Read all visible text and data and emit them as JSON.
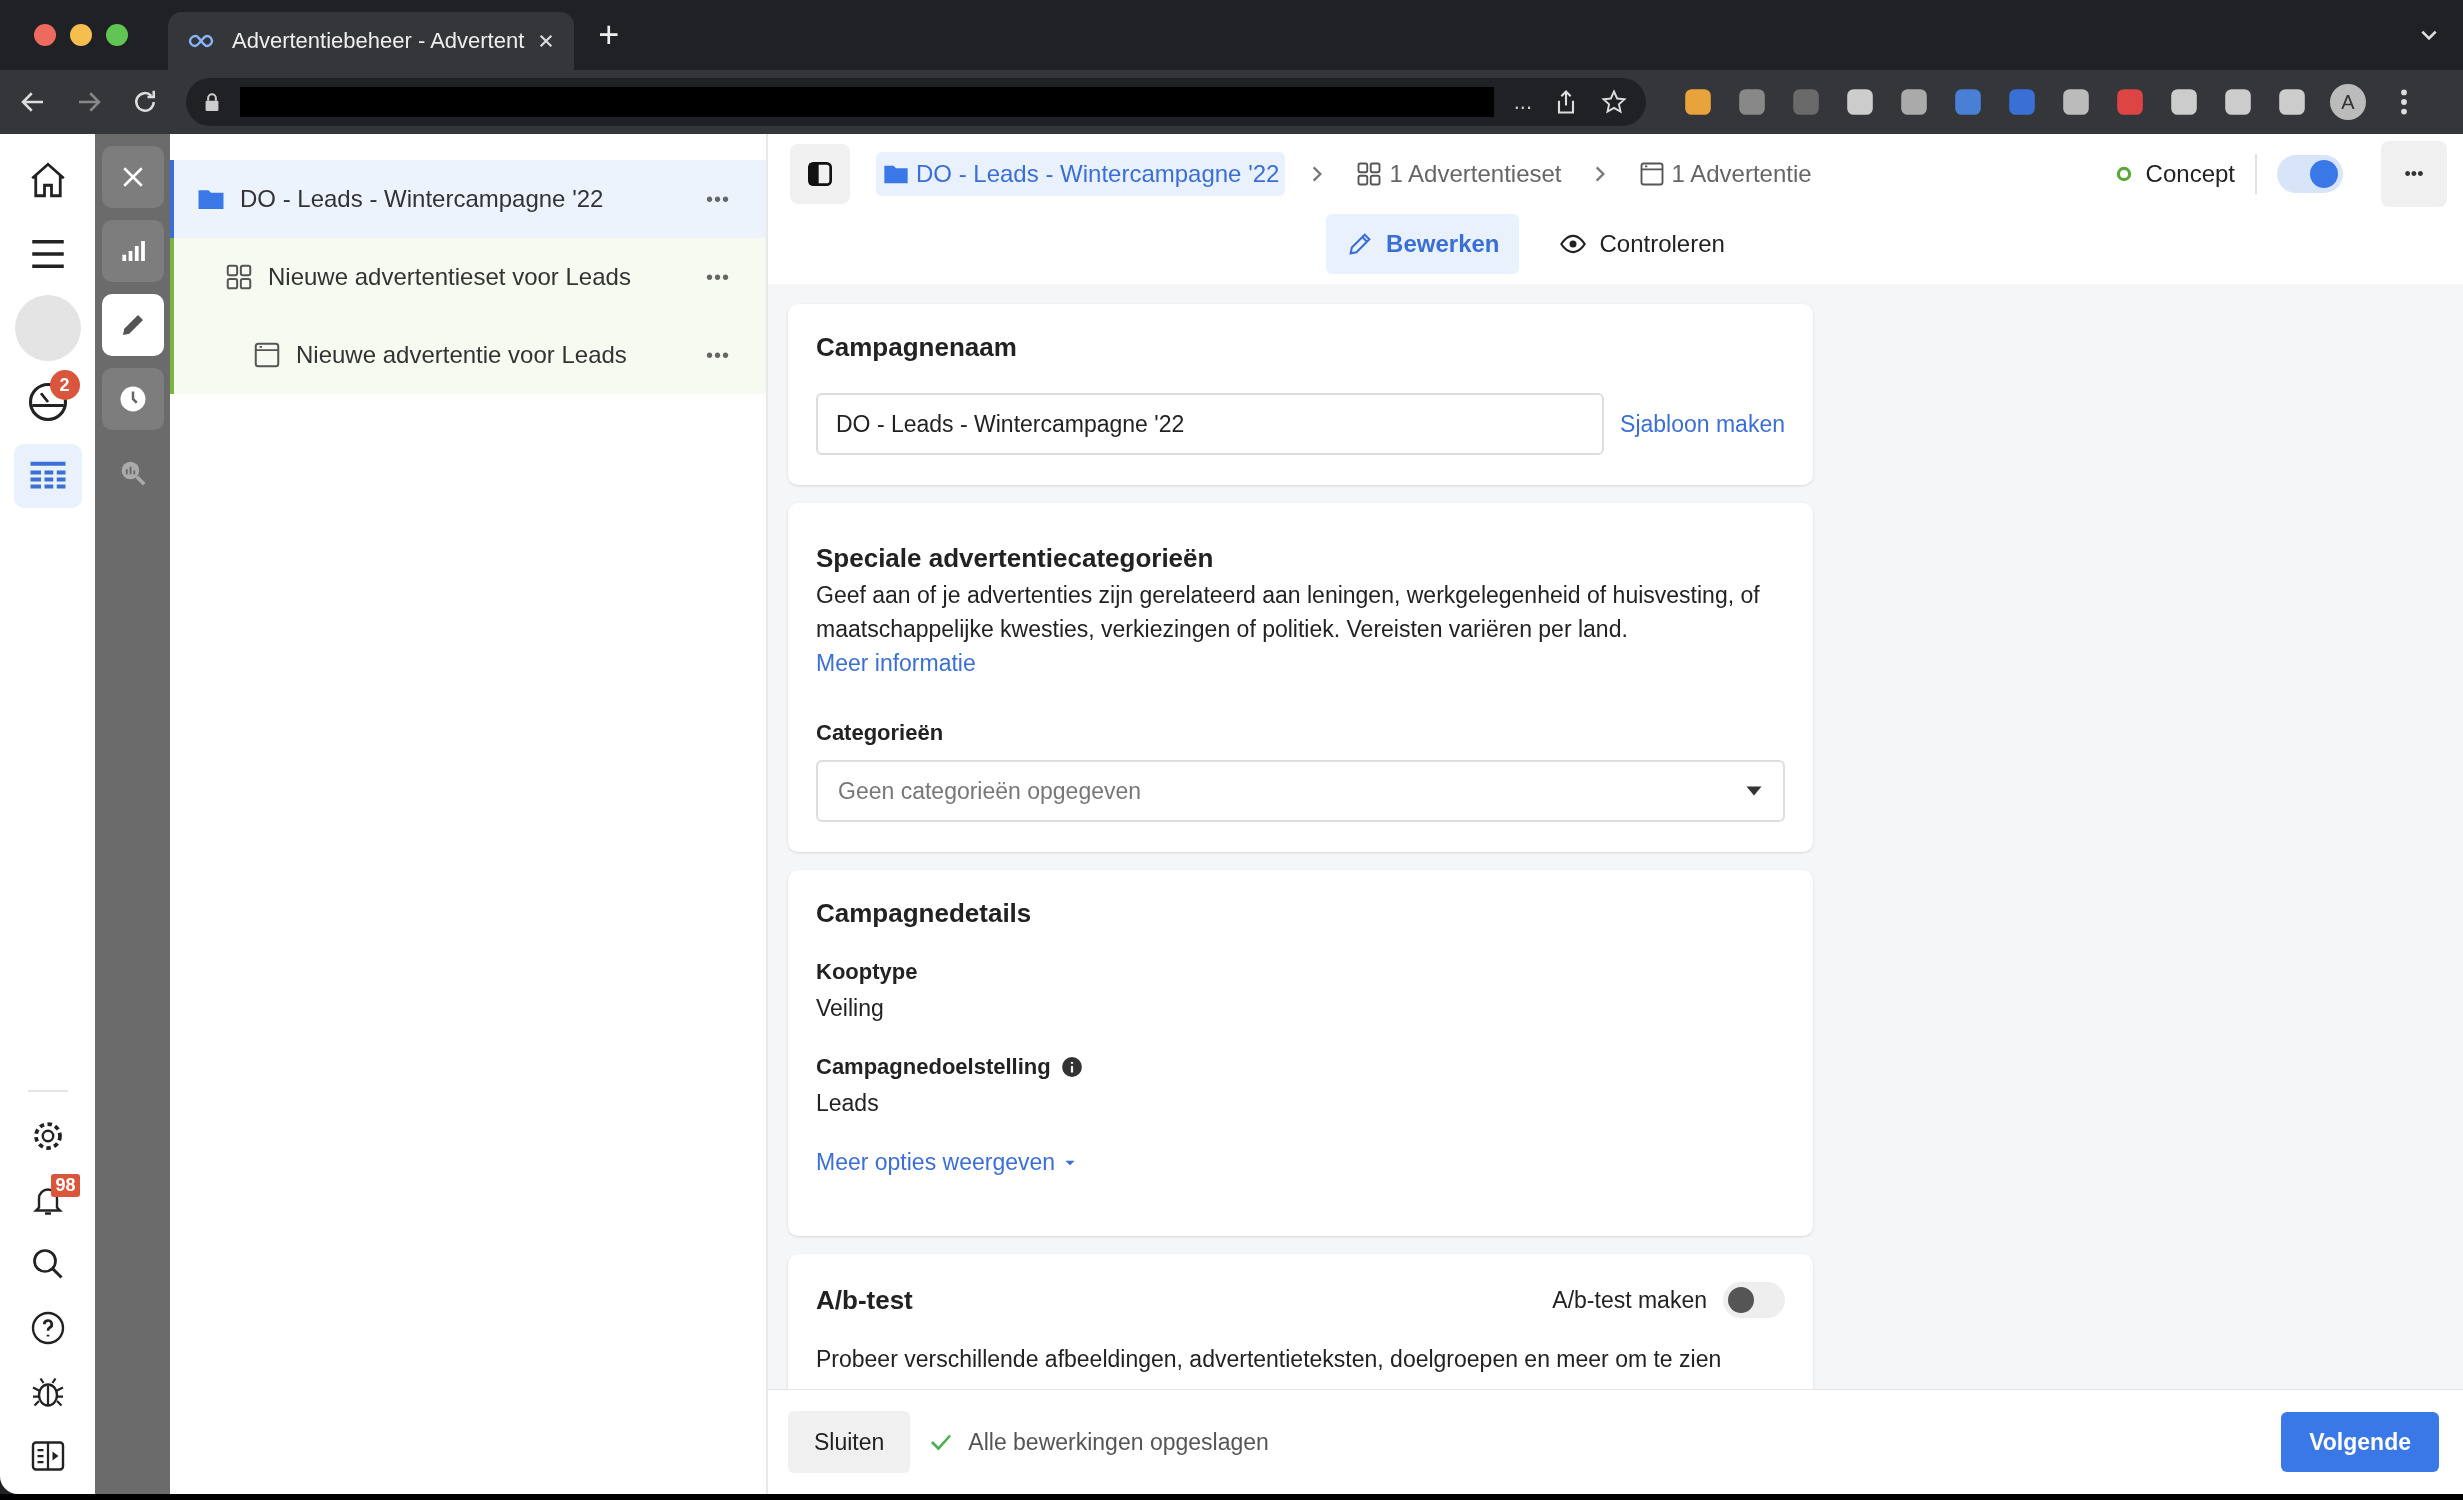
{
  "browser": {
    "tab_title": "Advertentiebeheer - Advertent",
    "new_tab": "+",
    "address_more": "...",
    "profile": "A"
  },
  "rail": {
    "top": [
      {
        "kind": "home",
        "selected": false
      },
      {
        "kind": "menu",
        "selected": false
      },
      {
        "kind": "avatar",
        "selected": false
      },
      {
        "kind": "gauge",
        "selected": false,
        "badge": "2"
      },
      {
        "kind": "grid",
        "selected": true
      }
    ],
    "bottom": [
      {
        "kind": "settings"
      },
      {
        "kind": "bell",
        "badge": "98"
      },
      {
        "kind": "search"
      },
      {
        "kind": "help"
      },
      {
        "kind": "bug"
      },
      {
        "kind": "panel"
      }
    ]
  },
  "tools": [
    {
      "kind": "close",
      "selected": false
    },
    {
      "kind": "chart",
      "selected": false
    },
    {
      "kind": "edit",
      "selected": true
    },
    {
      "kind": "clock",
      "selected": false
    },
    {
      "kind": "zoom",
      "selected": false
    }
  ],
  "tree": [
    {
      "label": "DO - Leads - Wintercampagne '22",
      "kind": "campaign",
      "selected": true,
      "more": "•••",
      "children": [
        {
          "label": "Nieuwe advertentieset voor Leads",
          "kind": "adset",
          "selected": false,
          "more": "•••",
          "children": [
            {
              "label": "Nieuwe advertentie voor Leads",
              "kind": "ad",
              "selected": false,
              "more": "•••"
            }
          ]
        }
      ]
    }
  ],
  "breadcrumb": [
    {
      "label": "DO - Leads - Wintercampagne '22",
      "kind": "campaign",
      "selected": true
    },
    {
      "label": "1 Advertentieset",
      "kind": "adset",
      "selected": false
    },
    {
      "label": "1 Advertentie",
      "kind": "ad",
      "selected": false
    }
  ],
  "status": {
    "label": "Concept",
    "on": true,
    "more": "•••"
  },
  "tabs": [
    {
      "label": "Bewerken",
      "kind": "edit",
      "selected": true
    },
    {
      "label": "Controleren",
      "kind": "view",
      "selected": false
    }
  ],
  "campaign_name": {
    "title": "Campagnenaam",
    "value": "DO - Leads - Wintercampagne '22",
    "link": "Sjabloon maken"
  },
  "special_categories": {
    "title": "Speciale advertentiecategorieën",
    "description": "Geef aan of je advertenties zijn gerelateerd aan leningen, werkgelegenheid of huisvesting, of maatschappelijke kwesties, verkiezingen of politiek. Vereisten variëren per land.",
    "link": "Meer informatie",
    "field_label": "Categorieën",
    "placeholder": "Geen categorieën opgegeven"
  },
  "campaign_details": {
    "title": "Campagnedetails",
    "fields": [
      {
        "label": "Kooptype",
        "value": "Veiling",
        "info": false
      },
      {
        "label": "Campagnedoelstelling",
        "value": "Leads",
        "info": true
      }
    ],
    "link": "Meer opties weergeven"
  },
  "ab_test": {
    "title": "A/b-test",
    "toggle_label": "A/b-test maken",
    "on": false,
    "text": "Probeer verschillende afbeeldingen, advertentieteksten, doelgroepen en meer om te zien"
  },
  "footer": {
    "close": "Sluiten",
    "saved": "Alle bewerkingen opgeslagen",
    "next": "Volgende"
  }
}
